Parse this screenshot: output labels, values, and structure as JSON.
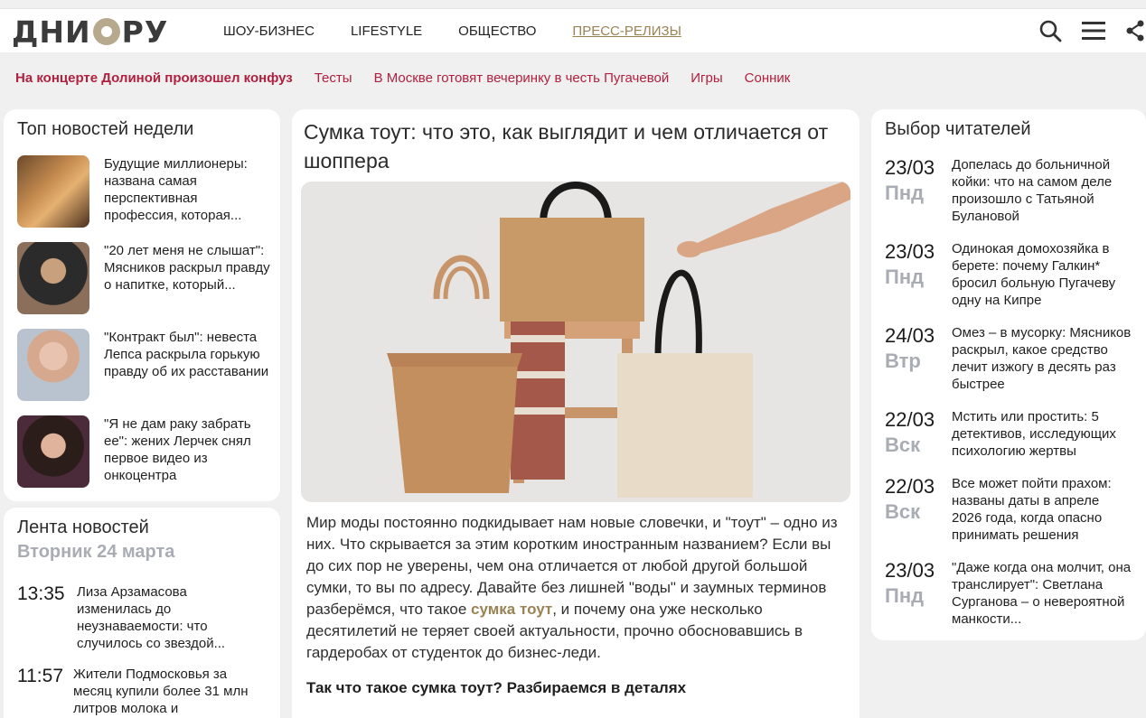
{
  "header": {
    "logo": "ДНИ.РУ",
    "logo_left": "ДНИ",
    "logo_right": "РУ",
    "nav": [
      "ШОУ-БИЗНЕС",
      "LIFESTYLE",
      "ОБЩЕСТВО",
      "ПРЕСС-РЕЛИЗЫ"
    ]
  },
  "subnav": [
    "На концерте Долиной произошел конфуз",
    "Тесты",
    "В Москве готовят вечеринку в честь Пугачевой",
    "Игры",
    "Сонник"
  ],
  "top_news": {
    "title": "Топ новостей недели",
    "items": [
      "Будущие миллионеры: названа самая перспективная профессия, которая...",
      "\"20 лет меня не слышат\": Мясников раскрыл правду о напитке, который...",
      "\"Контракт был\": невеста Лепса раскрыла горькую правду об их расставании",
      "\"Я не дам раку забрать ее\": жених Лерчек снял первое видео из онкоцентра"
    ]
  },
  "lenta": {
    "title": "Лента новостей",
    "date": "Вторник 24 марта",
    "items": [
      {
        "time": "13:35",
        "text": "Лиза Арзамасова изменилась до неузнаваемости: что случилось со звездой..."
      },
      {
        "time": "11:57",
        "text": "Жители Подмосковья за месяц купили более 31 млн литров молока и"
      }
    ]
  },
  "article": {
    "title": "Сумка тоут: что это, как выглядит и чем отличается от шоппера",
    "body_before": "Мир моды постоянно подкидывает нам новые словечки, и \"тоут\" – одно из них. Что скрывается за этим коротким иностранным названием? Если вы до сих пор не уверены, чем она отличается от любой другой большой сумки, то вы по адресу. Давайте без лишней \"воды\" и заумных терминов разберёмся, что такое ",
    "body_link": "сумка тоут",
    "body_after": ", и почему она уже несколько десятилетий не теряет своей актуальности, прочно обосновавшись в гардеробах от студенток до бизнес-леди.",
    "subheading": "Так что такое сумка тоут? Разбираемся в деталях"
  },
  "readers": {
    "title": "Выбор читателей",
    "items": [
      {
        "date": "23/03",
        "weekday": "Пнд",
        "text": "Допелась до больничной койки: что на самом деле произошло с Татьяной Булановой"
      },
      {
        "date": "23/03",
        "weekday": "Пнд",
        "text": "Одинокая домохозяйка в берете: почему Галкин* бросил больную Пугачеву одну на Кипре"
      },
      {
        "date": "24/03",
        "weekday": "Втр",
        "text": "Омез – в мусорку: Мясников раскрыл, какое средство лечит изжогу в десять раз быстрее"
      },
      {
        "date": "22/03",
        "weekday": "Вск",
        "text": "Мстить или простить: 5 детективов, исследующих психологию жертвы"
      },
      {
        "date": "22/03",
        "weekday": "Вск",
        "text": "Все может пойти прахом: названы даты в апреле 2026 года, когда опасно принимать решения"
      },
      {
        "date": "23/03",
        "weekday": "Пнд",
        "text": "\"Даже когда она молчит, она транслирует\": Светлана Сурганова – о невероятной манкости..."
      }
    ]
  },
  "icons": [
    "search-icon",
    "menu-icon",
    "share-icon"
  ],
  "colors": {
    "accent": "#b0203f",
    "gold": "#9a8254",
    "muted": "#a9adb3"
  }
}
